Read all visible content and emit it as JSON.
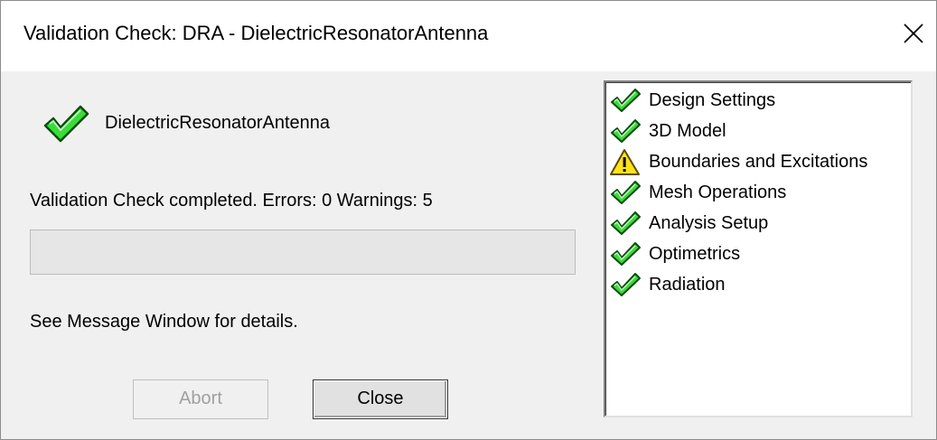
{
  "window": {
    "title": "Validation Check: DRA - DielectricResonatorAntenna"
  },
  "project": {
    "name": "DielectricResonatorAntenna",
    "status_icon": "check-icon"
  },
  "status": {
    "message": "Validation Check completed.   Errors: 0   Warnings: 5",
    "progress_percent": 0,
    "details": "See Message Window for details."
  },
  "buttons": {
    "abort_label": "Abort",
    "close_label": "Close"
  },
  "checks": [
    {
      "label": "Design Settings",
      "icon": "check-icon"
    },
    {
      "label": "3D Model",
      "icon": "check-icon"
    },
    {
      "label": "Boundaries and Excitations",
      "icon": "warning-icon"
    },
    {
      "label": "Mesh Operations",
      "icon": "check-icon"
    },
    {
      "label": "Analysis Setup",
      "icon": "check-icon"
    },
    {
      "label": "Optimetrics",
      "icon": "check-icon"
    },
    {
      "label": "Radiation",
      "icon": "check-icon"
    }
  ],
  "colors": {
    "check_green": "#3adb3a",
    "check_outline": "#0a4d0a",
    "warning_yellow": "#ffe21a"
  }
}
